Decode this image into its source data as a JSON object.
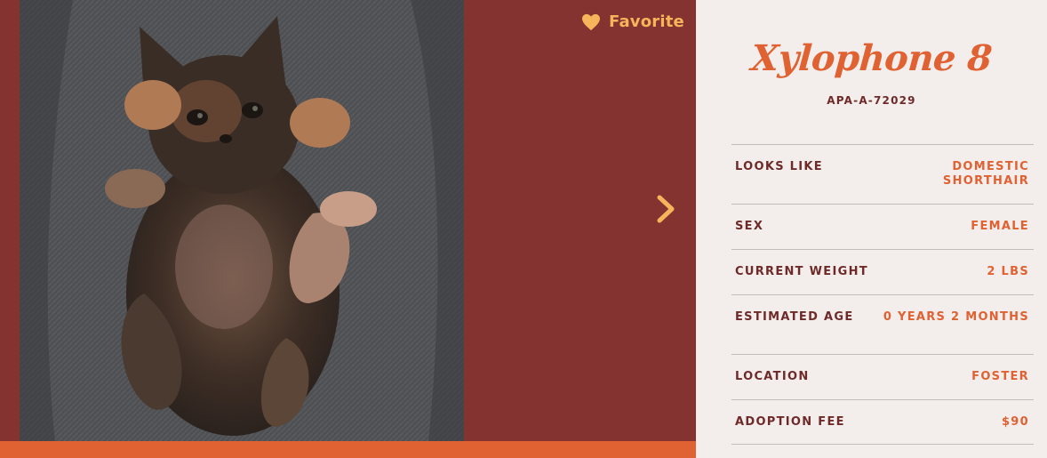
{
  "colors": {
    "maroon": "#853331",
    "orange": "#e06131",
    "gold": "#f6b55a",
    "cream": "#f3eeec",
    "label_dark": "#6e2a29"
  },
  "header": {
    "favorite_label": "Favorite",
    "favorite_icon": "heart-icon",
    "next_icon": "chevron-right-icon"
  },
  "pet": {
    "name": "Xylophone 8",
    "id": "APA-A-72029"
  },
  "details": [
    {
      "label": "LOOKS LIKE",
      "value": "DOMESTIC SHORTHAIR"
    },
    {
      "label": "SEX",
      "value": "FEMALE"
    },
    {
      "label": "CURRENT WEIGHT",
      "value": "2 LBS"
    },
    {
      "label": "ESTIMATED AGE",
      "value": "0 YEARS 2 MONTHS"
    },
    {
      "label": "LOCATION",
      "value": "FOSTER"
    },
    {
      "label": "ADOPTION FEE",
      "value": "$90"
    }
  ]
}
